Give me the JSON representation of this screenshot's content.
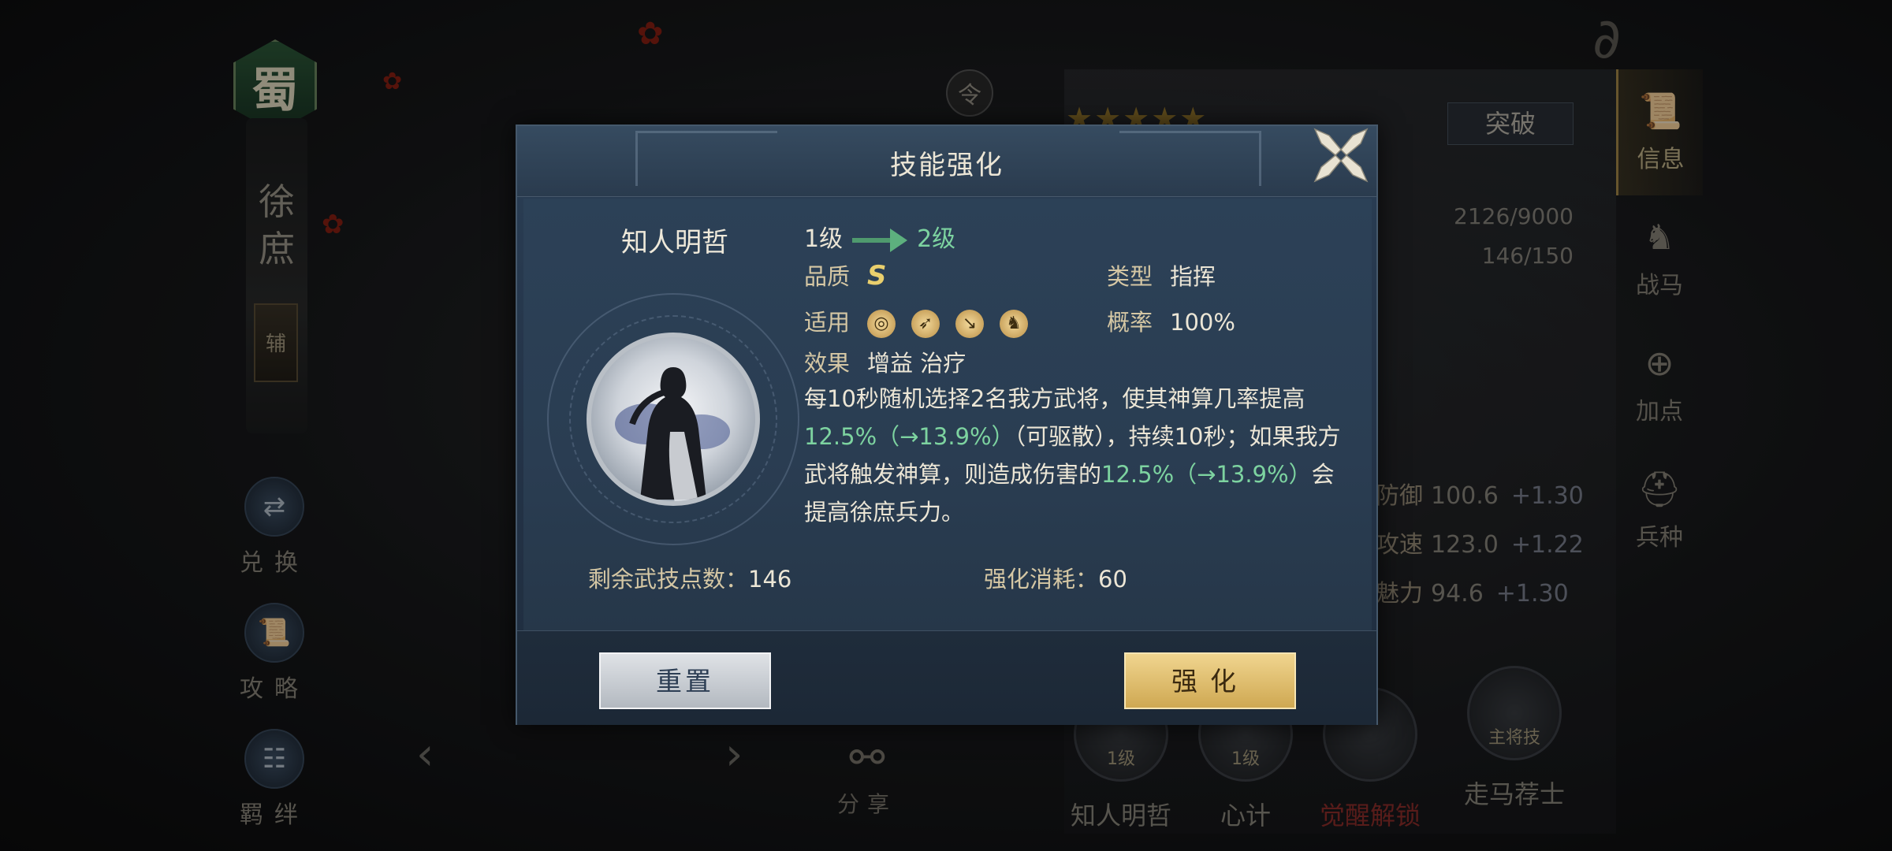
{
  "background": {
    "faction": "蜀",
    "hero_name_chars": [
      "徐",
      "庶"
    ],
    "role_tag": "辅",
    "left_menu": [
      {
        "label": "兑换",
        "icon": "exchange-icon"
      },
      {
        "label": "攻略",
        "icon": "scroll-icon"
      },
      {
        "label": "羁绊",
        "icon": "bond-icon"
      }
    ],
    "share_label": "分享",
    "ling_token": "令",
    "breakthrough_label": "突破",
    "stars": "★★★★★",
    "exp_text": "2126/9000",
    "troop_text": "146/150",
    "stats": [
      {
        "label": "防御",
        "value": "100.6",
        "plus": "+1.30"
      },
      {
        "label": "攻速",
        "value": "123.0",
        "plus": "+1.22"
      },
      {
        "label": "魅力",
        "value": "94.6",
        "plus": "+1.30"
      }
    ],
    "right_tabs": [
      {
        "label": "信息",
        "icon": "scroll-icon",
        "active": true
      },
      {
        "label": "战马",
        "icon": "horse-icon",
        "active": false
      },
      {
        "label": "加点",
        "icon": "armor-plus-icon",
        "active": false
      },
      {
        "label": "兵种",
        "icon": "helmet-icon",
        "active": false
      }
    ],
    "skills": [
      {
        "name": "知人明哲",
        "level": "1级",
        "red": false
      },
      {
        "name": "心计",
        "level": "1级",
        "red": false
      },
      {
        "name": "觉醒解锁",
        "level": "",
        "red": true
      },
      {
        "name": "走马荐士",
        "level": "主将技",
        "red": false
      }
    ]
  },
  "dialog": {
    "title": "技能强化",
    "skill_name": "知人明哲",
    "level_from": "1级",
    "level_to": "2级",
    "quality_label": "品质",
    "quality_value": "S",
    "type_label": "类型",
    "type_value": "指挥",
    "applicable_label": "适用",
    "applicable_icons": [
      "shield-icon",
      "bow-icon",
      "spear-icon",
      "horse-icon"
    ],
    "chance_label": "概率",
    "chance_value": "100%",
    "effect_label": "效果",
    "effect_value": "增益 治疗",
    "description": {
      "p1": "每10秒随机选择2名我方武将，使其神算几率提高",
      "g1": "12.5%（→13.9%）",
      "p2": "（可驱散），持续10秒；如果我方武将触发神算，则造成伤害的",
      "g2": "12.5%（→13.9%）",
      "p3": "会提高徐庶兵力。"
    },
    "remaining_points_label": "剩余武技点数：",
    "remaining_points_value": "146",
    "cost_label": "强化消耗：",
    "cost_value": "60",
    "reset_label": "重置",
    "enhance_label": "强化"
  },
  "colors": {
    "accent_green": "#7dd3a0",
    "grade_gold": "#e9cf6d",
    "dialog_bg": "#243449"
  }
}
